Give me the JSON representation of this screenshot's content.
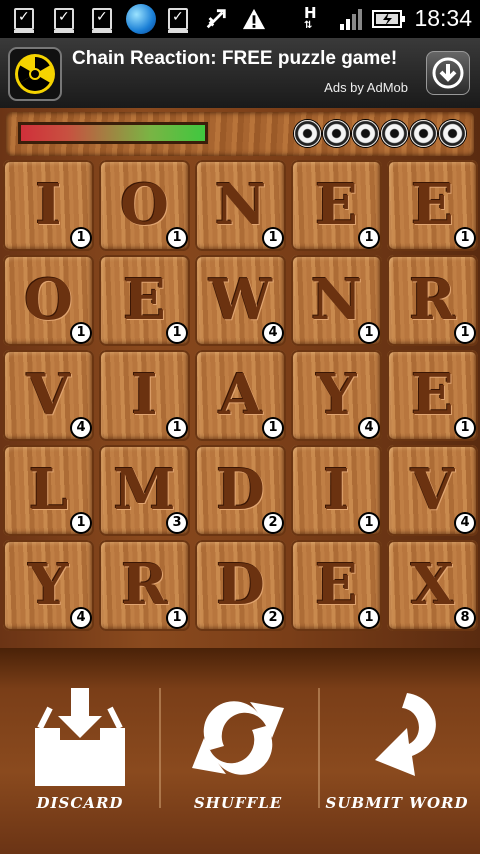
{
  "status_bar": {
    "icons": [
      "notification-icon",
      "notification-icon",
      "notification-icon",
      "browser-icon",
      "notification-icon",
      "usb-icon",
      "warning-icon",
      "network-icon",
      "signal-icon",
      "battery-icon"
    ],
    "network_type": "H",
    "time": "18:34"
  },
  "ad": {
    "title": "Chain Reaction: FREE puzzle game!",
    "subtitle": "Ads by AdMob",
    "icon": "radiation-icon",
    "action_icon": "download-icon"
  },
  "game": {
    "progress": 0.6,
    "lives_count": 6,
    "tiles": [
      {
        "letter": "I",
        "score": "1"
      },
      {
        "letter": "O",
        "score": "1"
      },
      {
        "letter": "N",
        "score": "1"
      },
      {
        "letter": "E",
        "score": "1"
      },
      {
        "letter": "E",
        "score": "1"
      },
      {
        "letter": "O",
        "score": "1"
      },
      {
        "letter": "E",
        "score": "1"
      },
      {
        "letter": "W",
        "score": "4"
      },
      {
        "letter": "N",
        "score": "1"
      },
      {
        "letter": "R",
        "score": "1"
      },
      {
        "letter": "V",
        "score": "4"
      },
      {
        "letter": "I",
        "score": "1"
      },
      {
        "letter": "A",
        "score": "1"
      },
      {
        "letter": "Y",
        "score": "4"
      },
      {
        "letter": "E",
        "score": "1"
      },
      {
        "letter": "L",
        "score": "1"
      },
      {
        "letter": "M",
        "score": "3"
      },
      {
        "letter": "D",
        "score": "2"
      },
      {
        "letter": "I",
        "score": "1"
      },
      {
        "letter": "V",
        "score": "4"
      },
      {
        "letter": "Y",
        "score": "4"
      },
      {
        "letter": "R",
        "score": "1"
      },
      {
        "letter": "D",
        "score": "2"
      },
      {
        "letter": "E",
        "score": "1"
      },
      {
        "letter": "X",
        "score": "8"
      }
    ]
  },
  "actions": {
    "discard": "DISCARD",
    "shuffle": "SHUFFLE",
    "submit": "SUBMIT WORD"
  },
  "colors": {
    "wood": "#b8763e",
    "letter": "#6b3210"
  }
}
